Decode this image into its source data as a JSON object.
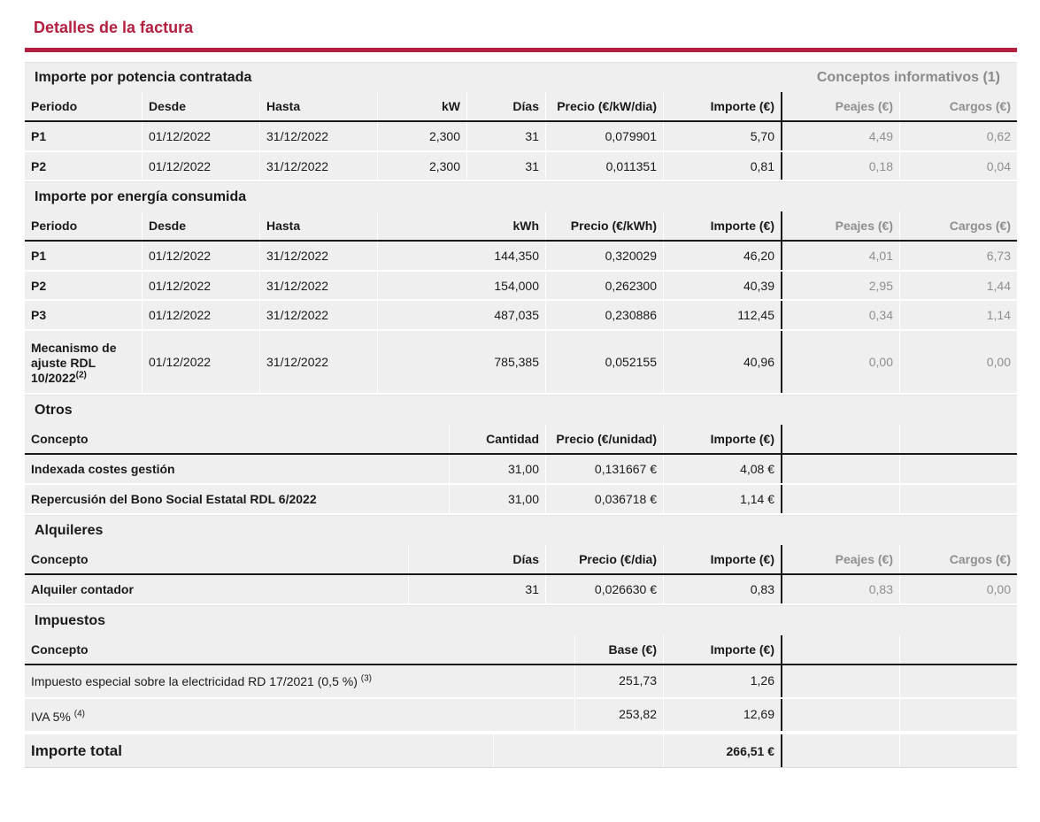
{
  "page": {
    "title": "Detalles de la factura"
  },
  "potencia": {
    "title": "Importe por potencia contratada",
    "info_title": "Conceptos informativos (1)",
    "headers": [
      "Periodo",
      "Desde",
      "Hasta",
      "kW",
      "Días",
      "Precio (€/kW/dia)",
      "Importe (€)",
      "Peajes (€)",
      "Cargos (€)"
    ],
    "rows": [
      [
        "P1",
        "01/12/2022",
        "31/12/2022",
        "2,300",
        "31",
        "0,079901",
        "5,70",
        "4,49",
        "0,62"
      ],
      [
        "P2",
        "01/12/2022",
        "31/12/2022",
        "2,300",
        "31",
        "0,011351",
        "0,81",
        "0,18",
        "0,04"
      ]
    ]
  },
  "energia": {
    "title": "Importe por energía consumida",
    "headers": [
      "Periodo",
      "Desde",
      "Hasta",
      "kWh",
      "Precio (€/kWh)",
      "Importe (€)",
      "Peajes (€)",
      "Cargos (€)"
    ],
    "rows": [
      [
        "P1",
        "01/12/2022",
        "31/12/2022",
        "144,350",
        "0,320029",
        "46,20",
        "4,01",
        "6,73"
      ],
      [
        "P2",
        "01/12/2022",
        "31/12/2022",
        "154,000",
        "0,262300",
        "40,39",
        "2,95",
        "1,44"
      ],
      [
        "P3",
        "01/12/2022",
        "31/12/2022",
        "487,035",
        "0,230886",
        "112,45",
        "0,34",
        "1,14"
      ]
    ],
    "mecanismo": {
      "label": "Mecanismo de ajuste RDL 10/2022",
      "note": "(2)",
      "desde": "01/12/2022",
      "hasta": "31/12/2022",
      "kwh": "785,385",
      "precio": "0,052155",
      "importe": "40,96",
      "peajes": "0,00",
      "cargos": "0,00"
    }
  },
  "otros": {
    "title": "Otros",
    "headers": [
      "Concepto",
      "Cantidad",
      "Precio (€/unidad)",
      "Importe (€)"
    ],
    "rows": [
      [
        "Indexada costes gestión",
        "31,00",
        "0,131667 €",
        "4,08 €"
      ],
      [
        "Repercusión del Bono Social Estatal RDL 6/2022",
        "31,00",
        "0,036718 €",
        "1,14 €"
      ]
    ]
  },
  "alquileres": {
    "title": "Alquileres",
    "headers": [
      "Concepto",
      "Días",
      "Precio (€/dia)",
      "Importe (€)",
      "Peajes (€)",
      "Cargos (€)"
    ],
    "rows": [
      [
        "Alquiler contador",
        "31",
        "0,026630 €",
        "0,83",
        "0,83",
        "0,00"
      ]
    ]
  },
  "impuestos": {
    "title": "Impuestos",
    "headers": [
      "Concepto",
      "Base (€)",
      "Importe (€)"
    ],
    "rows": [
      {
        "concepto": "Impuesto especial sobre la electricidad RD 17/2021 (0,5 %)",
        "note": "(3)",
        "base": "251,73",
        "importe": "1,26"
      },
      {
        "concepto": "IVA 5%",
        "note": "(4)",
        "base": "253,82",
        "importe": "12,69"
      }
    ]
  },
  "total": {
    "label": "Importe total",
    "value": "266,51 €"
  }
}
